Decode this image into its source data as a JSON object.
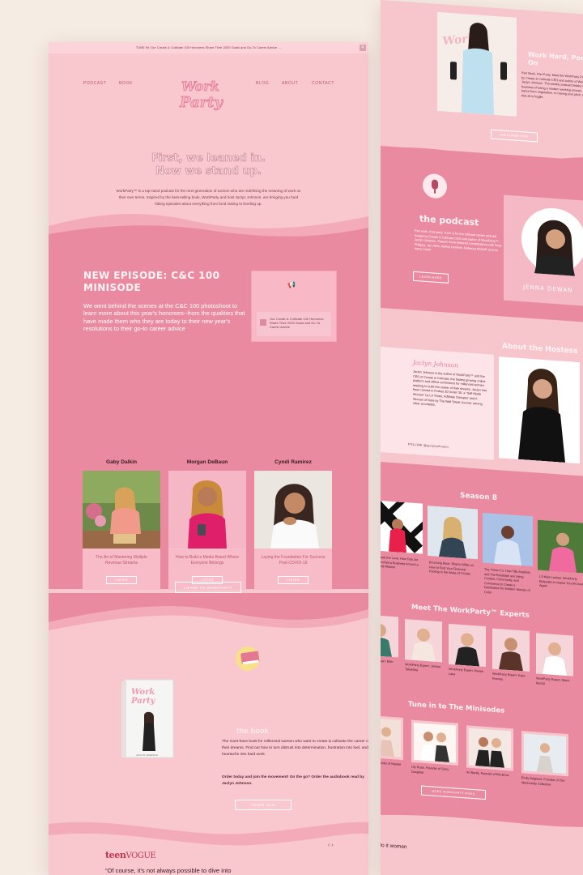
{
  "announcement": "TUNE IN: Our Create & Cultivate 100 Honorees Share Their 2020 Goals and Go-To Career Advice →",
  "nav": {
    "left": [
      "PODCAST",
      "BOOK"
    ],
    "right": [
      "BLOG",
      "ABOUT",
      "CONTACT"
    ]
  },
  "hero": {
    "title_line1": "First, we leaned in.",
    "title_line2": "Now we stand up.",
    "description": "WorkParty™ is a top-rated podcast for the next-generation of women who are redefining the meaning of work on their own terms. Inspired by the best-selling book, WorkParty and host Jaclyn Johnson, are bringing you hard hitting episodes about everything from fund raising to leveling up."
  },
  "new_episode": {
    "title": "NEW EPISODE: C&C 100 MINISODE",
    "text": "We went behind the scenes at the C&C 100 photoshoot to learn more about this year's honorees--from the qualities that have made them who they are today to their new year's resolutions to their go-to career advice",
    "player_text": "Our Create & Cultivate 100 Honorees Share Their 2020 Goals and Go-To Career Advice"
  },
  "guests": [
    {
      "name": "Gaby Dalkin",
      "episode": "The Art of Mastering Multiple Revenue Streams",
      "button": "LISTEN"
    },
    {
      "name": "Morgan DeBaun",
      "episode": "How to Build a Media Brand Where Everyone Belongs",
      "button": "LISTEN"
    },
    {
      "name": "Cyndi Ramirez",
      "episode": "Laying the Foundation For Success Post-COVID-19",
      "button": "LISTEN"
    }
  ],
  "listen_all": "LISTEN TO WORKPARTY",
  "book": {
    "title": "the book",
    "text": "The must-have book for millennial women who want to create & cultivate the career of their dreams. Find out how to turn distrust into determination, frustration into fuel, and heartache into hard work.",
    "order": "Order today and join the movement! On the go? Order the audiobook read by Jaclyn Johnson.",
    "button": "ORDER NOW"
  },
  "press": {
    "logo_bold": "teen",
    "logo_rest": "VOGUE",
    "quote": "“Of course, it's not always possible to dive into",
    "nav": "‹ ›"
  },
  "right_page": {
    "top_title": "Work Hard, Podcast On",
    "top_text": "Part Work, Part Party. Meet the WorkParty Podcast hosted by Create & Cultivate CEO and author of WorkParty™ Jaclyn Johnson. The weekly podcast breaks down the business of being a modern working woman, by tackling topics from negotiation, to having your pitch, to realizing that all is fragile.",
    "top_button": "SUBSCRIBE NOW",
    "podcast_title": "the podcast",
    "podcast_text": "Part work, Part party. Tune in for the ultimate career podcast hosted by Create & Cultivate CEO and author of WorkParty™, Jaclyn Johnson. Season three featured conversations with Busy Philipps, Jen Atkin, Ashley Graham, Rebecca Minkoff, and so many more!",
    "podcast_button": "LEARN MORE",
    "guest_name": "JENNA DEWAN",
    "hostess_title": "About the Hostess",
    "hostess_name": "Jaclyn Johnson",
    "hostess_text": "Jaclyn Johnson is the author of WorkParty™ and the CEO of Create & Cultivate, the fastest growing online platform and offline conference for millennial women seeking to build the career of their dreams. Jaclyn has been named to Forbes 30 Under 30, a “Self-Made Woman” by LA Times, AdWeek Disruptor and A Woman of Note by The Wall Street Journal, among other accolades.",
    "follow": "FOLLOW @jaclynjohnson",
    "season_title": "Season 8",
    "season_items": [
      "Spread the Love: How Tata Jar Launched a Business Around a Social Mission",
      "Bouncing Back: Sharon Miller on How to Find Your Financial Footing in the Wake of COVID",
      "The Three C's: How Tilla Ampiloin and The Randolph are Using Content, Community, and Commerce to Create a Destination for Modern Women of Color",
      "L'il Mixe Lashes: WorkParty Episodes to Inspire You All Over Again"
    ],
    "experts_title": "Meet The WorkParty™ Experts",
    "experts": [
      "WorkParty Expert: Blair Decembrele",
      "WorkParty Expert: Jemma Takeshita",
      "WorkParty Expert: Reese Lake",
      "WorkParty Expert: Katie Rooney",
      "WorkParty Expert: Marni McGill"
    ],
    "minisodes_title": "Tune in to The Minisodes",
    "minisodes": [
      "Natalie Rose, Founder of Natalie Rose",
      "Lily Rose, Founder of Sorry Daughter",
      "Ari Bartle, Founder of Bia Brow",
      "Emily Belgrave, Founder of The Mentorship Collective"
    ],
    "minisodes_button": "MORE WORKPARTY MINIS",
    "bottom_quote": "“Listen to it women"
  }
}
